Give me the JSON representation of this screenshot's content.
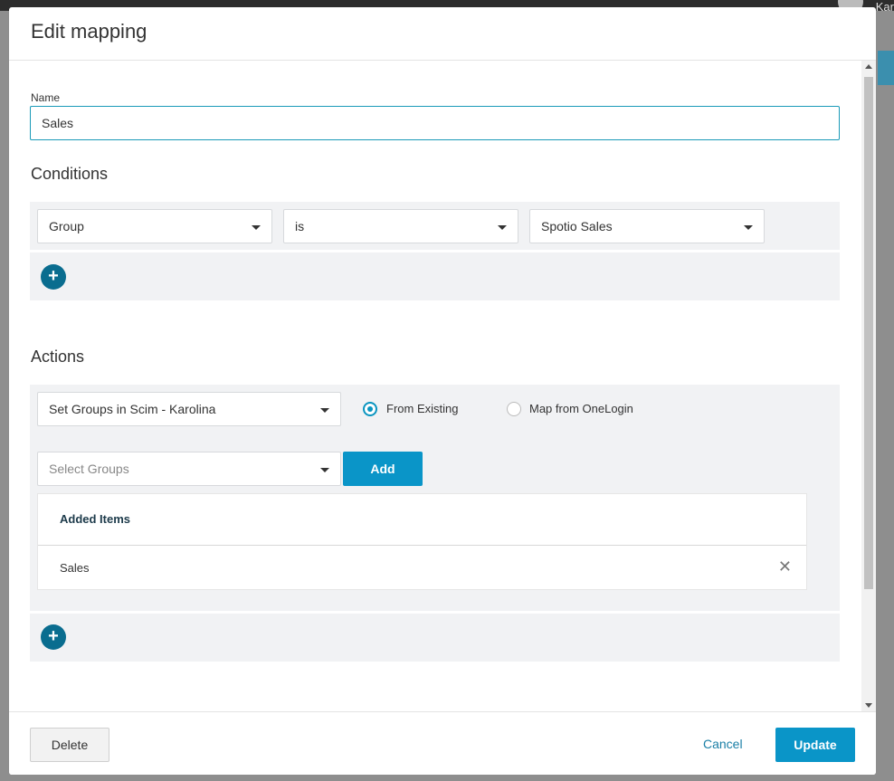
{
  "background": {
    "user_partial": "Kar"
  },
  "modal": {
    "title": "Edit mapping",
    "name_label": "Name",
    "name_value": "Sales",
    "conditions": {
      "title": "Conditions",
      "field": "Group",
      "operator": "is",
      "value": "Spotio Sales"
    },
    "actions": {
      "title": "Actions",
      "action_select": "Set Groups in Scim - Karolina",
      "radio_from_existing": "From Existing",
      "radio_map_from_onelogin": "Map from OneLogin",
      "selected_radio": "From Existing",
      "groups_placeholder": "Select Groups",
      "add_label": "Add",
      "added_items_header": "Added Items",
      "added_items": [
        "Sales"
      ]
    },
    "footer": {
      "delete_label": "Delete",
      "cancel_label": "Cancel",
      "update_label": "Update"
    }
  },
  "colors": {
    "primary": "#0a95c8",
    "add_circle": "#0a6d8f",
    "input_border": "#1a9ab8"
  }
}
